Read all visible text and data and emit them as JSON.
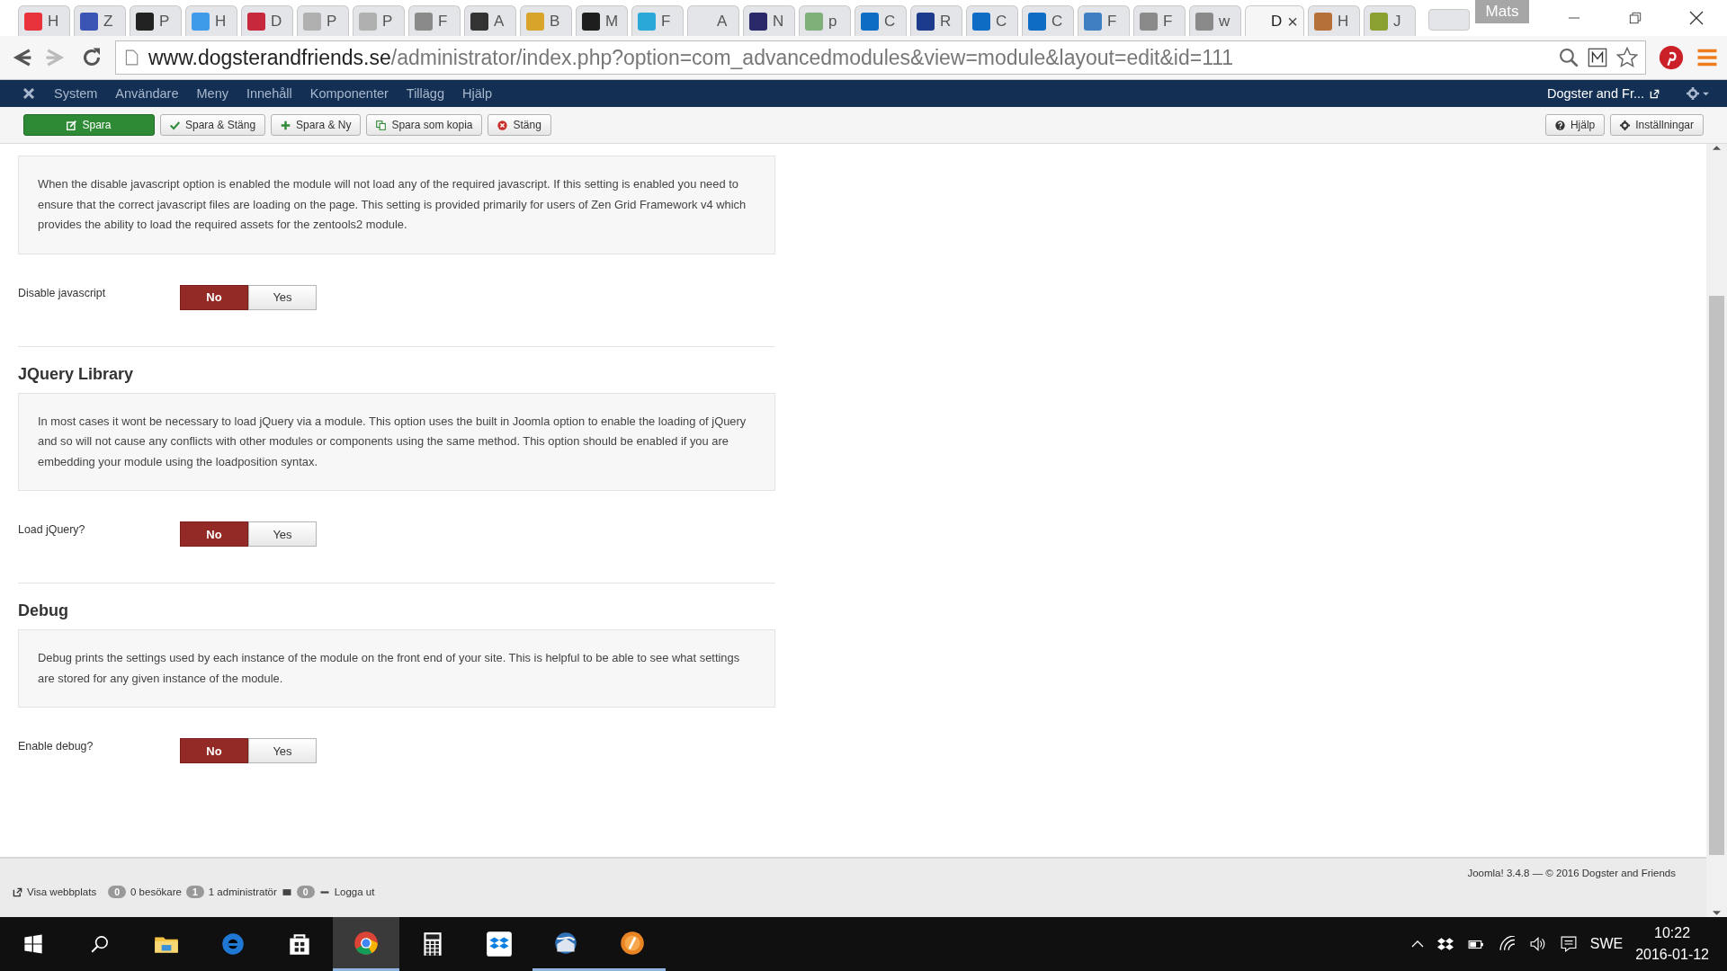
{
  "browser": {
    "tabs": [
      {
        "label": "H",
        "color": "#e8323c",
        "selected": false
      },
      {
        "label": "Z",
        "color": "#3a55b4",
        "selected": false
      },
      {
        "label": "P",
        "color": "#222222",
        "selected": false
      },
      {
        "label": "H",
        "color": "#3d9be9",
        "selected": false
      },
      {
        "label": "D",
        "color": "#c8283c",
        "selected": false
      },
      {
        "label": "P",
        "color": "#b0b0b0",
        "selected": false
      },
      {
        "label": "P",
        "color": "#b0b0b0",
        "selected": false
      },
      {
        "label": "F",
        "color": "#8a8a8a",
        "selected": false
      },
      {
        "label": "A",
        "color": "#333333",
        "selected": false
      },
      {
        "label": "B",
        "color": "#d9a42a",
        "selected": false
      },
      {
        "label": "M",
        "color": "#1e1e1e",
        "selected": false
      },
      {
        "label": "F",
        "color": "#2aa8d8",
        "selected": false
      },
      {
        "label": "A",
        "selected": false
      },
      {
        "label": "N",
        "color": "#2a2a6a",
        "selected": false
      },
      {
        "label": "p",
        "color": "#7fb07a",
        "selected": false
      },
      {
        "label": "C",
        "color": "#0f6cc4",
        "selected": false
      },
      {
        "label": "R",
        "color": "#1d3b8c",
        "selected": false
      },
      {
        "label": "C",
        "color": "#0f6cc4",
        "selected": false
      },
      {
        "label": "C",
        "color": "#0f6cc4",
        "selected": false
      },
      {
        "label": "F",
        "color": "#3f7fc2",
        "selected": false
      },
      {
        "label": "F",
        "color": "#8a8a8a",
        "selected": false
      },
      {
        "label": "w",
        "color": "#8a8a8a",
        "selected": false
      },
      {
        "label": "D",
        "selected": true,
        "close": "×"
      },
      {
        "label": "H",
        "color": "#b5703a",
        "selected": false
      },
      {
        "label": "J",
        "color": "#8aa030",
        "selected": false
      }
    ],
    "profile": "Mats",
    "url_host": "www.dogsterandfriends.se",
    "url_path": "/administrator/index.php?option=com_advancedmodules&view=module&layout=edit&id=111"
  },
  "admin_menu": {
    "items": [
      "System",
      "Användare",
      "Meny",
      "Innehåll",
      "Komponenter",
      "Tillägg",
      "Hjälp"
    ],
    "site_link": "Dogster and Fr..."
  },
  "toolbar": {
    "buttons": [
      {
        "label": "Spara",
        "kind": "primary"
      },
      {
        "label": "Spara & Stäng",
        "kind": "check"
      },
      {
        "label": "Spara & Ny",
        "kind": "plus"
      },
      {
        "label": "Spara som kopia",
        "kind": "copy"
      },
      {
        "label": "Stäng",
        "kind": "cancel"
      }
    ],
    "right_buttons": [
      {
        "label": "Hjälp",
        "kind": "help"
      },
      {
        "label": "Inställningar",
        "kind": "gear"
      }
    ]
  },
  "sections": [
    {
      "description": "When the disable javascript option is enabled the module will not load any of the required javascript. If this setting is enabled you need to ensure that the correct javascript files are loading on the page. This setting is provided primarily for users of Zen Grid Framework v4 which provides the ability to load the required assets for the zentools2 module.",
      "field": {
        "label": "Disable javascript",
        "options": [
          {
            "label": "No",
            "selected": true
          },
          {
            "label": "Yes",
            "selected": false
          }
        ]
      }
    },
    {
      "heading": "JQuery Library",
      "description": "In most cases it wont be necessary to load jQuery via a module. This option uses the built in Joomla option to enable the loading of jQuery and so will not cause any conflicts with other modules or components using the same method. This option should be enabled if you are embedding your module using the loadposition syntax.",
      "field": {
        "label": "Load jQuery?",
        "options": [
          {
            "label": "No",
            "selected": true
          },
          {
            "label": "Yes",
            "selected": false
          }
        ]
      }
    },
    {
      "heading": "Debug",
      "description": "Debug prints the settings used by each instance of the module on the front end of your site. This is helpful to be able to see what settings are stored for any given instance of the module.",
      "field": {
        "label": "Enable debug?",
        "options": [
          {
            "label": "No",
            "selected": true
          },
          {
            "label": "Yes",
            "selected": false
          }
        ]
      }
    }
  ],
  "footer": {
    "view_site": "Visa webbplats",
    "visitors_count": "0",
    "visitors": "0 besökare",
    "admins_count": "1",
    "admins": "1 administratör",
    "messages_count": "0",
    "logout": "Logga ut",
    "copyright": "Joomla! 3.4.8 — © 2016 Dogster and Friends"
  },
  "taskbar": {
    "apps": [
      {
        "running": false,
        "active": false
      },
      {
        "running": false,
        "active": false
      },
      {
        "running": false,
        "active": false
      },
      {
        "running": true,
        "active": true
      },
      {
        "running": false,
        "active": false
      },
      {
        "running": false,
        "active": false
      },
      {
        "running": true,
        "active": false
      },
      {
        "running": true,
        "active": false
      }
    ],
    "language": "SWE",
    "time": "10:22",
    "date": "2016-01-12"
  }
}
